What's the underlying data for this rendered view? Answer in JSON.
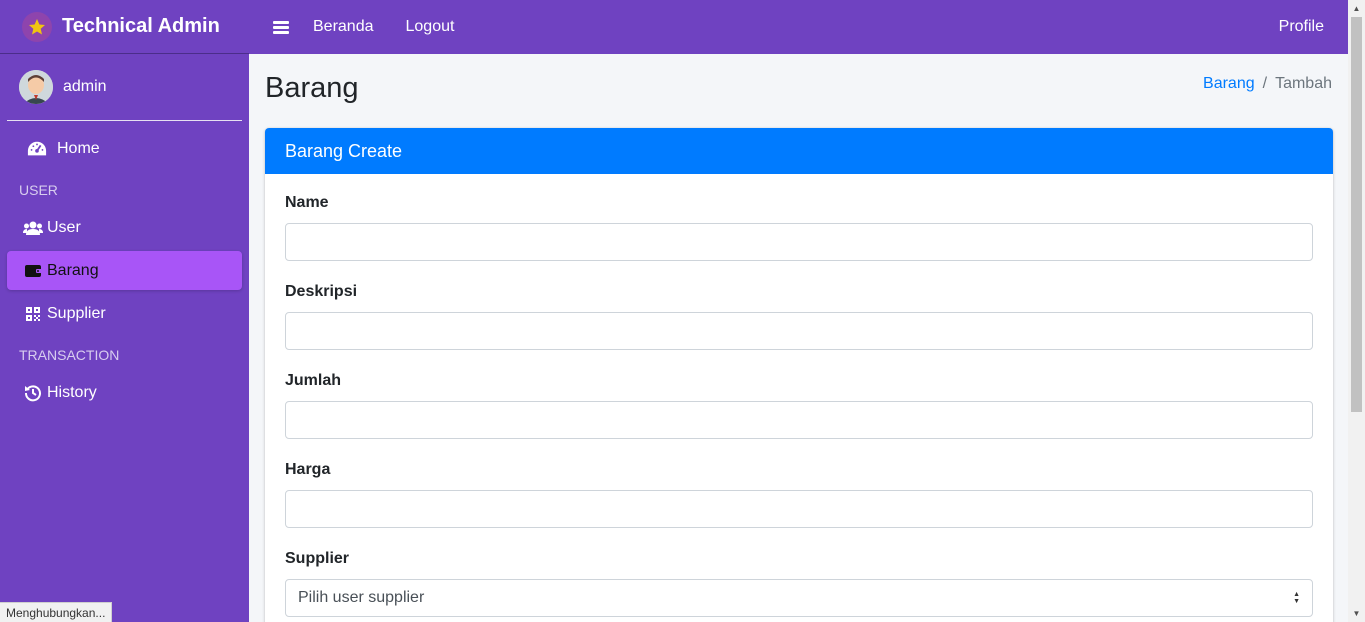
{
  "brand": {
    "title": "Technical Admin"
  },
  "user": {
    "name": "admin"
  },
  "sidebar": {
    "items": [
      {
        "label": "Home"
      },
      {
        "header": "USER"
      },
      {
        "label": "User"
      },
      {
        "label": "Barang"
      },
      {
        "label": "Supplier"
      },
      {
        "header": "TRANSACTION"
      },
      {
        "label": "History"
      }
    ]
  },
  "topbar": {
    "links": [
      "Beranda",
      "Logout"
    ],
    "profile": "Profile"
  },
  "page": {
    "title": "Barang",
    "breadcrumb": {
      "link": "Barang",
      "separator": "/",
      "active": "Tambah"
    }
  },
  "form": {
    "header": "Barang Create",
    "fields": [
      {
        "label": "Name",
        "value": ""
      },
      {
        "label": "Deskripsi",
        "value": ""
      },
      {
        "label": "Jumlah",
        "value": ""
      },
      {
        "label": "Harga",
        "value": ""
      }
    ],
    "supplier": {
      "label": "Supplier",
      "selected": "Pilih user supplier"
    }
  },
  "status": {
    "text": "Menghubungkan..."
  },
  "colors": {
    "sidebar": "#6f42c1",
    "active_item": "#a855f7",
    "card_header": "#007bff",
    "link": "#007bff"
  }
}
